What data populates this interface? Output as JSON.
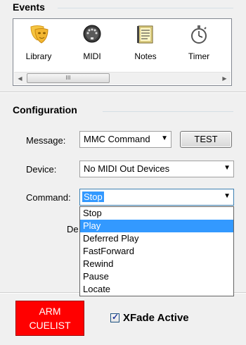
{
  "events": {
    "title": "Events",
    "items": [
      {
        "label": "Library",
        "icon": "theater-masks-icon"
      },
      {
        "label": "MIDI",
        "icon": "midi-plug-icon"
      },
      {
        "label": "Notes",
        "icon": "notepad-icon"
      },
      {
        "label": "Timer",
        "icon": "stopwatch-icon"
      }
    ],
    "scroll_thumb_grip": "III"
  },
  "configuration": {
    "title": "Configuration",
    "message": {
      "label": "Message:",
      "value": "MMC Command"
    },
    "test_label": "TEST",
    "device": {
      "label": "Device:",
      "value": "No MIDI Out Devices"
    },
    "command": {
      "label": "Command:",
      "value": "Stop",
      "options": [
        "Stop",
        "Play",
        "Deferred Play",
        "FastForward",
        "Rewind",
        "Pause",
        "Locate"
      ],
      "highlighted_option": "Play"
    },
    "hidden_label_fragment": "De"
  },
  "bottom": {
    "arm_line1": "ARM",
    "arm_line2": "CUELIST",
    "xfade_label": "XFade Active",
    "xfade_checked": true
  },
  "colors": {
    "arm": "#ff0000",
    "selection": "#3399ff"
  }
}
